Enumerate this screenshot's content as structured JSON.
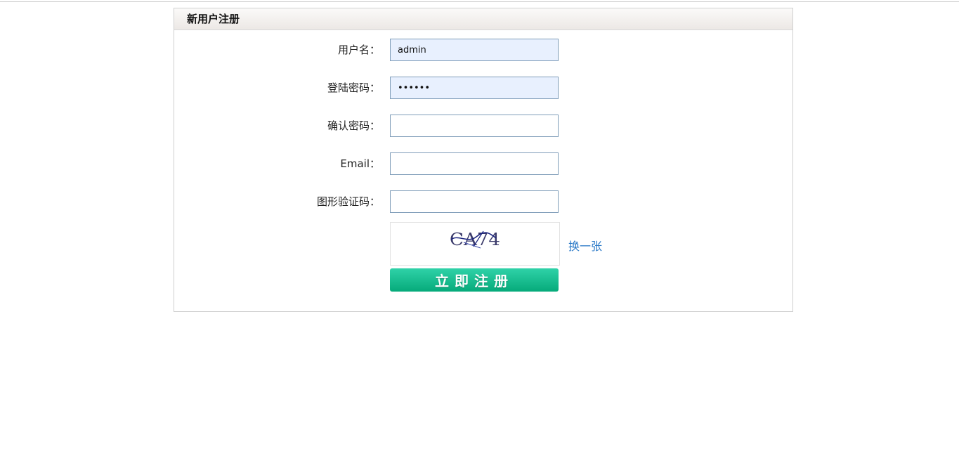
{
  "panel": {
    "title": "新用户注册"
  },
  "form": {
    "fields": [
      {
        "label": "用户名：",
        "value": "admin",
        "type": "text"
      },
      {
        "label": "登陆密码：",
        "value": "••••••",
        "type": "password"
      },
      {
        "label": "确认密码：",
        "value": "",
        "type": "password"
      },
      {
        "label": "Email：",
        "value": "",
        "type": "text"
      },
      {
        "label": "图形验证码：",
        "value": "",
        "type": "text"
      }
    ],
    "captcha_text": "CA74",
    "refresh_label": "换一张",
    "submit_label": "立即注册"
  },
  "colors": {
    "input_border": "#7f9db9",
    "autofill_bg": "#e8f0fe",
    "link": "#2a79c7",
    "button_top": "#2fd2a8",
    "button_bottom": "#06aa7a"
  }
}
